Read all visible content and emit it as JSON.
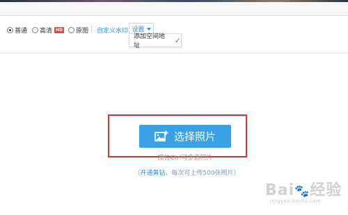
{
  "toolbar": {
    "quality_options": [
      {
        "label": "普通",
        "checked": true
      },
      {
        "label": "高清",
        "checked": false,
        "badge": "HD"
      },
      {
        "label": "原图",
        "checked": false
      }
    ],
    "custom_watermark_link": "自定义水印",
    "settings_label": "设置"
  },
  "dropdown": {
    "item_label": "添加空间地址",
    "item_checked": true
  },
  "upload": {
    "button_label": "选择照片",
    "hint": "按住Ctrl可多选照片",
    "promo_prefix": "（",
    "promo_link": "开通黄钻",
    "promo_suffix": "，每次可上传500张照片）"
  },
  "watermark": {
    "logo_prefix": "Bai",
    "logo_suffix": "经验",
    "url": "jingyan.baidu.com"
  },
  "colors": {
    "accent": "#3aa2e4",
    "link": "#3a8ed6",
    "highlight": "#d9302a",
    "hd_badge": "#e04a3a"
  }
}
